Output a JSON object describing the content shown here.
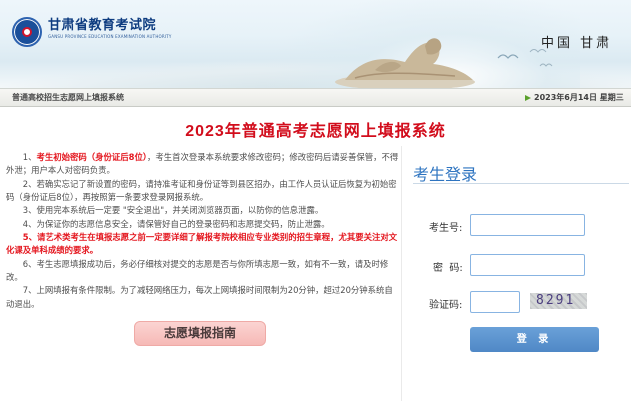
{
  "header": {
    "logo_cn": "甘肃省教育考试院",
    "logo_en": "GANSU PROVINCE EDUCATION EXAMINATION AUTHORITY",
    "region_text": "中国 甘肃"
  },
  "navbar": {
    "system_name": "普通高校招生志愿网上填报系统",
    "date_text": "2023年6月14日 星期三"
  },
  "main": {
    "title": "2023年普通高考志愿网上填报系统",
    "notices": [
      {
        "text": "1、",
        "red": "考生初始密码（身份证后8位）",
        "rest": "，考生首次登录本系统要求修改密码；修改密码后请妥善保管，不得外泄；用户本人对密码负责。"
      },
      {
        "text": "2、若确实忘记了新设置的密码，请持准考证和身份证等到县区招办，由工作人员认证后恢复为初始密码（身份证后8位），再按照第一条要求登录网报系统。"
      },
      {
        "text": "3、使用完本系统后一定要 \"安全退出\"，并关闭浏览器页面，以防你的信息泄露。"
      },
      {
        "text": "4、为保证你的志愿信息安全，请保管好自己的登录密码和志愿提交码，防止泄露。"
      },
      {
        "text": "5、请艺术类考生在填报志愿之前一定要详细了解报考院校相应专业类别的招生章程，尤其要关注对文化课及单科成绩的要求。",
        "is_red": true
      },
      {
        "text": "6、考生志愿填报成功后，务必仔细核对提交的志愿是否与你所填志愿一致，如有不一致，请及时修改。"
      },
      {
        "text": "7、上网填报有条件限制。为了减轻网络压力，每次上网填报时间限制为20分钟，超过20分钟系统自动退出。"
      }
    ],
    "guide_button": "志愿填报指南"
  },
  "login": {
    "title": "考生登录",
    "exam_no_label": "考生号:",
    "password_label": "密  码:",
    "captcha_label": "验证码:",
    "exam_no_value": "",
    "password_value": "",
    "captcha_value": "",
    "captcha_code": "8291",
    "submit_label": "登 录"
  },
  "colors": {
    "title_red": "#d20d1c",
    "notice_red": "#e4161e",
    "login_blue": "#2e74c0",
    "button_blue": "#4f88c6",
    "guide_pink": "#f6b9b6"
  }
}
